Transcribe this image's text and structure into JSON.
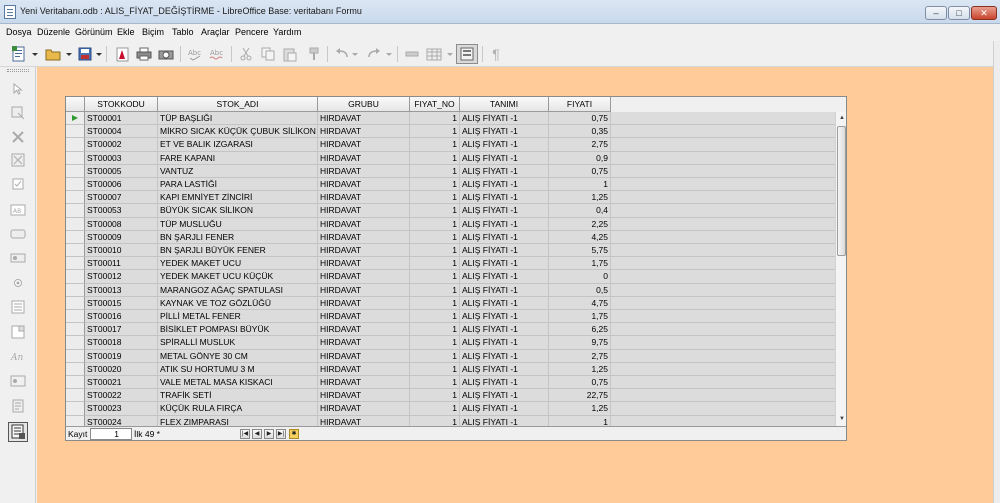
{
  "window": {
    "title": "Yeni Veritabanı.odb : ALIS_FİYAT_DEĞİŞTİRME - LibreOffice Base: veritabanı Formu",
    "minimize": "–",
    "maximize": "□",
    "close": "✕"
  },
  "menu": [
    "Dosya",
    "Düzenle",
    "Görünüm",
    "Ekle",
    "Biçim",
    "Tablo",
    "Araçlar",
    "Pencere",
    "Yardım"
  ],
  "toolbar": {
    "icons": [
      "new-document-icon",
      "open-icon",
      "save-icon",
      "export-pdf-icon",
      "print-icon",
      "print-preview-icon",
      "spellcheck-icon",
      "autospell-icon",
      "cut-icon",
      "copy-icon",
      "paste-icon",
      "clone-format-icon",
      "undo-icon",
      "redo-icon",
      "form-navigator-icon",
      "table-icon",
      "design-mode-icon",
      "formatting-marks-icon"
    ],
    "formatting_marks_glyph": "¶"
  },
  "grid": {
    "columns": [
      "",
      "STOKKODU",
      "STOK_ADI",
      "GRUBU",
      "FIYAT_NO",
      "TANIMI",
      "FIYATI"
    ],
    "rows": [
      [
        "ST00001",
        "TÜP BAŞLIĞI",
        "HIRDAVAT",
        "1",
        "ALIŞ FİYATI -1",
        "0,75"
      ],
      [
        "ST00004",
        "MİKRO SICAK KÜÇÜK ÇUBUK SİLİKON",
        "HIRDAVAT",
        "1",
        "ALIŞ FİYATI -1",
        "0,35"
      ],
      [
        "ST00002",
        "ET VE BALIK IZGARASI",
        "HIRDAVAT",
        "1",
        "ALIŞ FİYATI -1",
        "2,75"
      ],
      [
        "ST00003",
        "FARE KAPANI",
        "HIRDAVAT",
        "1",
        "ALIŞ FİYATI -1",
        "0,9"
      ],
      [
        "ST00005",
        "VANTUZ",
        "HIRDAVAT",
        "1",
        "ALIŞ FİYATI -1",
        "0,75"
      ],
      [
        "ST00006",
        "PARA LASTİĞİ",
        "HIRDAVAT",
        "1",
        "ALIŞ FİYATI -1",
        "1"
      ],
      [
        "ST00007",
        "KAPI EMNİYET ZİNCİRİ",
        "HIRDAVAT",
        "1",
        "ALIŞ FİYATI -1",
        "1,25"
      ],
      [
        "ST00053",
        "BÜYÜK SICAK SİLİKON",
        "HIRDAVAT",
        "1",
        "ALIŞ FİYATI -1",
        "0,4"
      ],
      [
        "ST00008",
        "TÜP MUSLUĞU",
        "HIRDAVAT",
        "1",
        "ALIŞ FİYATI -1",
        "2,25"
      ],
      [
        "ST00009",
        "BN ŞARJLI FENER",
        "HIRDAVAT",
        "1",
        "ALIŞ FİYATI -1",
        "4,25"
      ],
      [
        "ST00010",
        "BN ŞARJLI BÜYÜK FENER",
        "HIRDAVAT",
        "1",
        "ALIŞ FİYATI -1",
        "5,75"
      ],
      [
        "ST00011",
        "YEDEK MAKET UCU",
        "HIRDAVAT",
        "1",
        "ALIŞ FİYATI -1",
        "1,75"
      ],
      [
        "ST00012",
        "YEDEK MAKET UCU KÜÇÜK",
        "HIRDAVAT",
        "1",
        "ALIŞ FİYATI -1",
        "0"
      ],
      [
        "ST00013",
        "MARANGOZ AĞAÇ SPATULASI",
        "HIRDAVAT",
        "1",
        "ALIŞ FİYATI -1",
        "0,5"
      ],
      [
        "ST00015",
        "KAYNAK VE TOZ GÖZLÜĞÜ",
        "HIRDAVAT",
        "1",
        "ALIŞ FİYATI -1",
        "4,75"
      ],
      [
        "ST00016",
        "PİLLİ METAL FENER",
        "HIRDAVAT",
        "1",
        "ALIŞ FİYATI -1",
        "1,75"
      ],
      [
        "ST00017",
        "BİSİKLET POMPASI BÜYÜK",
        "HIRDAVAT",
        "1",
        "ALIŞ FİYATI -1",
        "6,25"
      ],
      [
        "ST00018",
        "SPİRALLİ MUSLUK",
        "HIRDAVAT",
        "1",
        "ALIŞ FİYATI -1",
        "9,75"
      ],
      [
        "ST00019",
        "METAL GÖNYE 30 CM",
        "HIRDAVAT",
        "1",
        "ALIŞ FİYATI -1",
        "2,75"
      ],
      [
        "ST00020",
        "ATIK SU HORTUMU 3 M",
        "HIRDAVAT",
        "1",
        "ALIŞ FİYATI -1",
        "1,25"
      ],
      [
        "ST00021",
        "VALE METAL MASA KISKACI",
        "HIRDAVAT",
        "1",
        "ALIŞ FİYATI -1",
        "0,75"
      ],
      [
        "ST00022",
        "TRAFİK SETİ",
        "HIRDAVAT",
        "1",
        "ALIŞ FİYATI -1",
        "22,75"
      ],
      [
        "ST00023",
        "KÜÇÜK RULA FIRÇA",
        "HIRDAVAT",
        "1",
        "ALIŞ FİYATI -1",
        "1,25"
      ],
      [
        "ST00024",
        "FLEX ZIMPARASI",
        "HIRDAVAT",
        "1",
        "ALIŞ FİYATI -1",
        "1"
      ]
    ]
  },
  "navigation": {
    "record_label": "Kayıt",
    "current_record": "1",
    "total_label": "İlk 49 *",
    "buttons": [
      "|◀",
      "◀",
      "▶",
      "▶|",
      "✱"
    ]
  },
  "colors": {
    "form_background": "#ffcc99",
    "row_background": "#dcdcdc",
    "cursor_arrow": "#2f9a2f"
  }
}
